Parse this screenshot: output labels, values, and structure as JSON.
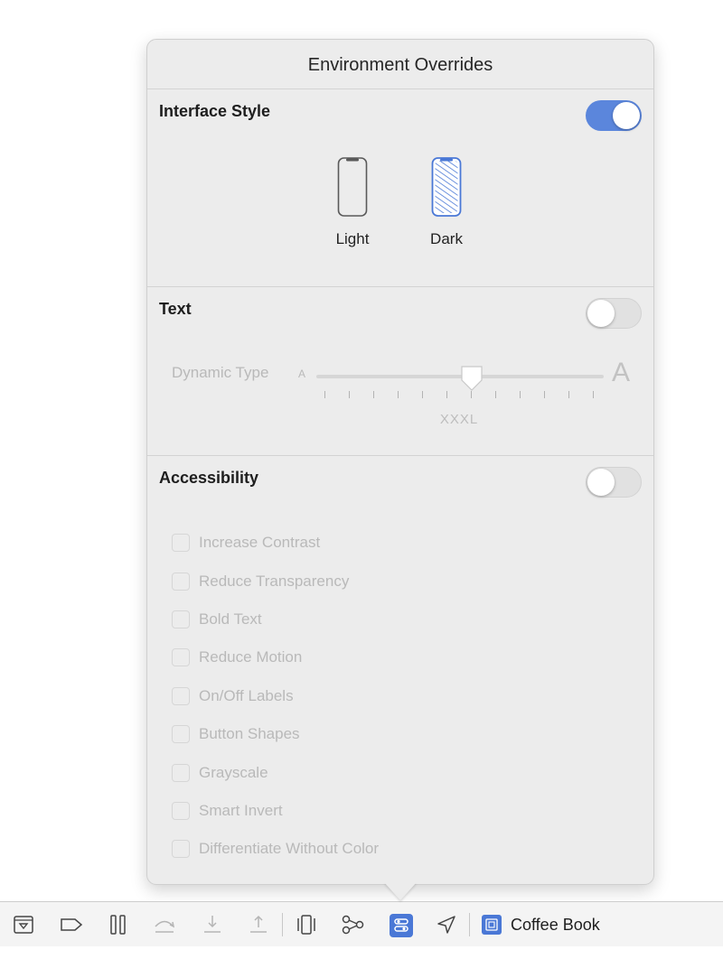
{
  "popover": {
    "title": "Environment Overrides",
    "interface_style": {
      "title": "Interface Style",
      "enabled": true,
      "options": [
        {
          "label": "Light",
          "selected": false
        },
        {
          "label": "Dark",
          "selected": true
        }
      ]
    },
    "text": {
      "title": "Text",
      "enabled": false,
      "dynamic_type_label": "Dynamic Type",
      "small_a": "A",
      "large_a": "A",
      "size_value": "XXXL",
      "slider_position": 0.53
    },
    "accessibility": {
      "title": "Accessibility",
      "enabled": false,
      "options": [
        {
          "label": "Increase Contrast",
          "checked": false
        },
        {
          "label": "Reduce Transparency",
          "checked": false
        },
        {
          "label": "Bold Text",
          "checked": false
        },
        {
          "label": "Reduce Motion",
          "checked": false
        },
        {
          "label": "On/Off Labels",
          "checked": false
        },
        {
          "label": "Button Shapes",
          "checked": false
        },
        {
          "label": "Grayscale",
          "checked": false
        },
        {
          "label": "Smart Invert",
          "checked": false
        },
        {
          "label": "Differentiate Without Color",
          "checked": false
        }
      ]
    }
  },
  "toolbar": {
    "buttons": [
      {
        "icon": "hide-debug-area-icon"
      },
      {
        "icon": "breakpoints-toggle-icon"
      },
      {
        "icon": "pause-icon"
      },
      {
        "icon": "step-over-icon"
      },
      {
        "icon": "step-into-icon"
      },
      {
        "icon": "step-out-icon"
      },
      {
        "icon": "view-hierarchy-icon"
      },
      {
        "icon": "memory-graph-icon"
      },
      {
        "icon": "environment-overrides-icon",
        "active": true
      },
      {
        "icon": "simulate-location-icon"
      }
    ],
    "scheme": {
      "label": "Coffee Book",
      "icon": "app-icon"
    }
  },
  "colors": {
    "accent": "#5b86dc",
    "panel_bg": "#ececec",
    "disabled_text": "#b9b9b9"
  }
}
